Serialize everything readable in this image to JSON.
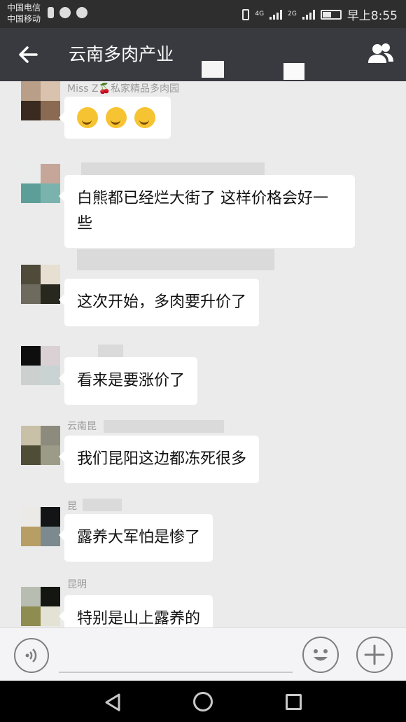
{
  "status_bar": {
    "carrier_1": "中国电信",
    "carrier_2": "中国移动",
    "network_1": "4G",
    "network_2": "2G",
    "time": "早上8:55"
  },
  "title_bar": {
    "back_icon": "back-arrow-icon",
    "title": "云南多肉产业",
    "members_icon": "group-members-icon"
  },
  "messages": [
    {
      "name": "Miss Z🍒私家精品多肉园",
      "text": "",
      "emoji_count": 3
    },
    {
      "name": "",
      "text": "白熊都已经烂大街了 这样价格会好一些"
    },
    {
      "name": "",
      "text": "这次开始，多肉要升价了"
    },
    {
      "name": "",
      "text": "看来是要涨价了"
    },
    {
      "name": "云南昆",
      "text": "我们昆阳这边都冻死很多"
    },
    {
      "name": "昆",
      "text": "露养大军怕是惨了"
    },
    {
      "name": "昆明",
      "text": "特别是山上露养的"
    }
  ],
  "input_bar": {
    "voice_icon": "voice-input-icon",
    "emoji_icon": "emoji-face-icon",
    "plus_icon": "plus-icon"
  },
  "nav_bar": {
    "back_icon": "nav-back-triangle-icon",
    "home_icon": "nav-home-circle-icon",
    "recent_icon": "nav-recent-square-icon"
  }
}
